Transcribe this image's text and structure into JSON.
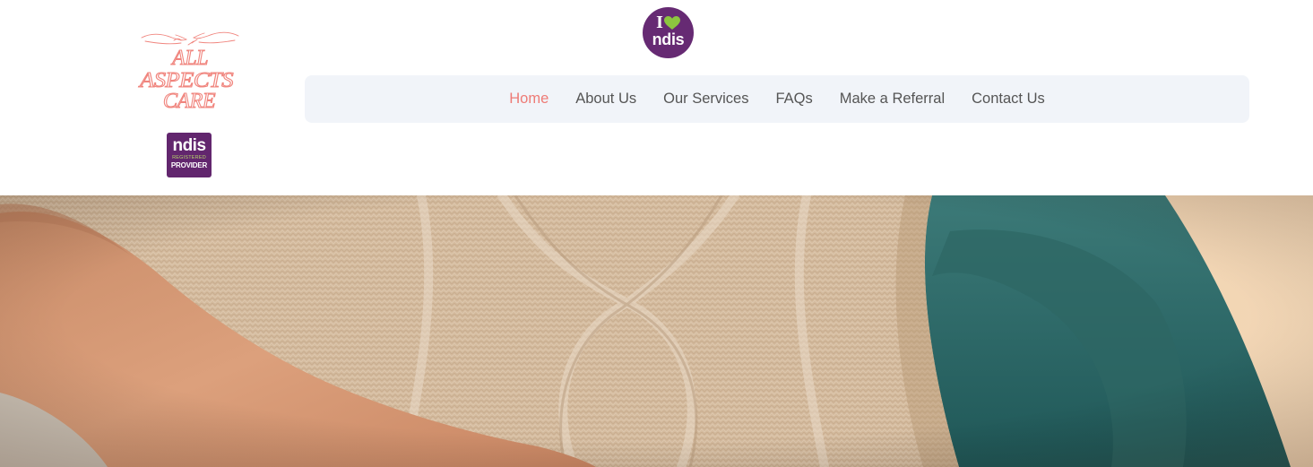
{
  "brand": {
    "logo_lines": [
      "ALL",
      "ASPECTS",
      "CARE"
    ],
    "logo_color": "#f0857e",
    "logo_icon": "hands-reaching-icon"
  },
  "badges": {
    "ilove": {
      "top": "I",
      "bottom": "ndis",
      "icon": "heart-icon",
      "color": "#662a73",
      "heart_color": "#8cc63f"
    },
    "provider": {
      "top": "ndis",
      "middle": "REGISTERED",
      "bottom": "PROVIDER",
      "color": "#62266e"
    }
  },
  "nav": {
    "items": [
      {
        "label": "Home",
        "active": true
      },
      {
        "label": "About Us",
        "active": false
      },
      {
        "label": "Our Services",
        "active": false
      },
      {
        "label": "FAQs",
        "active": false
      },
      {
        "label": "Make a Referral",
        "active": false
      },
      {
        "label": "Contact Us",
        "active": false
      }
    ],
    "active_color": "#ee7b76",
    "text_color": "#555555",
    "background": "#f1f4f9"
  },
  "hero": {
    "image": "knit-sweater-hands-photo",
    "colors": {
      "sweater": "#d8c2a8",
      "skin": "#d69a74",
      "teal": "#2f6a6a",
      "wall": "#efcfa7"
    }
  }
}
